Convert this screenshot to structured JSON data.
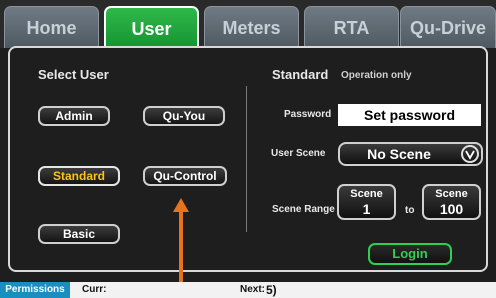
{
  "tabs": [
    {
      "label": "Home",
      "active": false
    },
    {
      "label": "User",
      "active": true
    },
    {
      "label": "Meters",
      "active": false
    },
    {
      "label": "RTA",
      "active": false
    },
    {
      "label": "Qu-Drive",
      "active": false
    }
  ],
  "select_user": {
    "title": "Select User",
    "buttons": {
      "admin": "Admin",
      "qu_you": "Qu-You",
      "standard": "Standard",
      "qu_control": "Qu-Control",
      "basic": "Basic"
    },
    "selected": "Standard"
  },
  "details": {
    "user_name": "Standard",
    "user_desc": "Operation only",
    "password_label": "Password",
    "password_value": "Set password",
    "user_scene_label": "User Scene",
    "user_scene_value": "No Scene",
    "scene_range_label": "Scene Range",
    "scene_from_title": "Scene",
    "scene_from_value": "1",
    "to_label": "to",
    "scene_to_title": "Scene",
    "scene_to_value": "100",
    "login_label": "Login"
  },
  "status": {
    "tab": "Permissions",
    "curr_label": "Curr:",
    "next_label": "Next:",
    "next_value": "5)"
  },
  "colors": {
    "active_tab": "#1c9e36",
    "selected_text": "#ffc21a",
    "login_accent": "#2fd04f",
    "arrow": "#e8731e",
    "status_tab": "#1a8fbf"
  }
}
